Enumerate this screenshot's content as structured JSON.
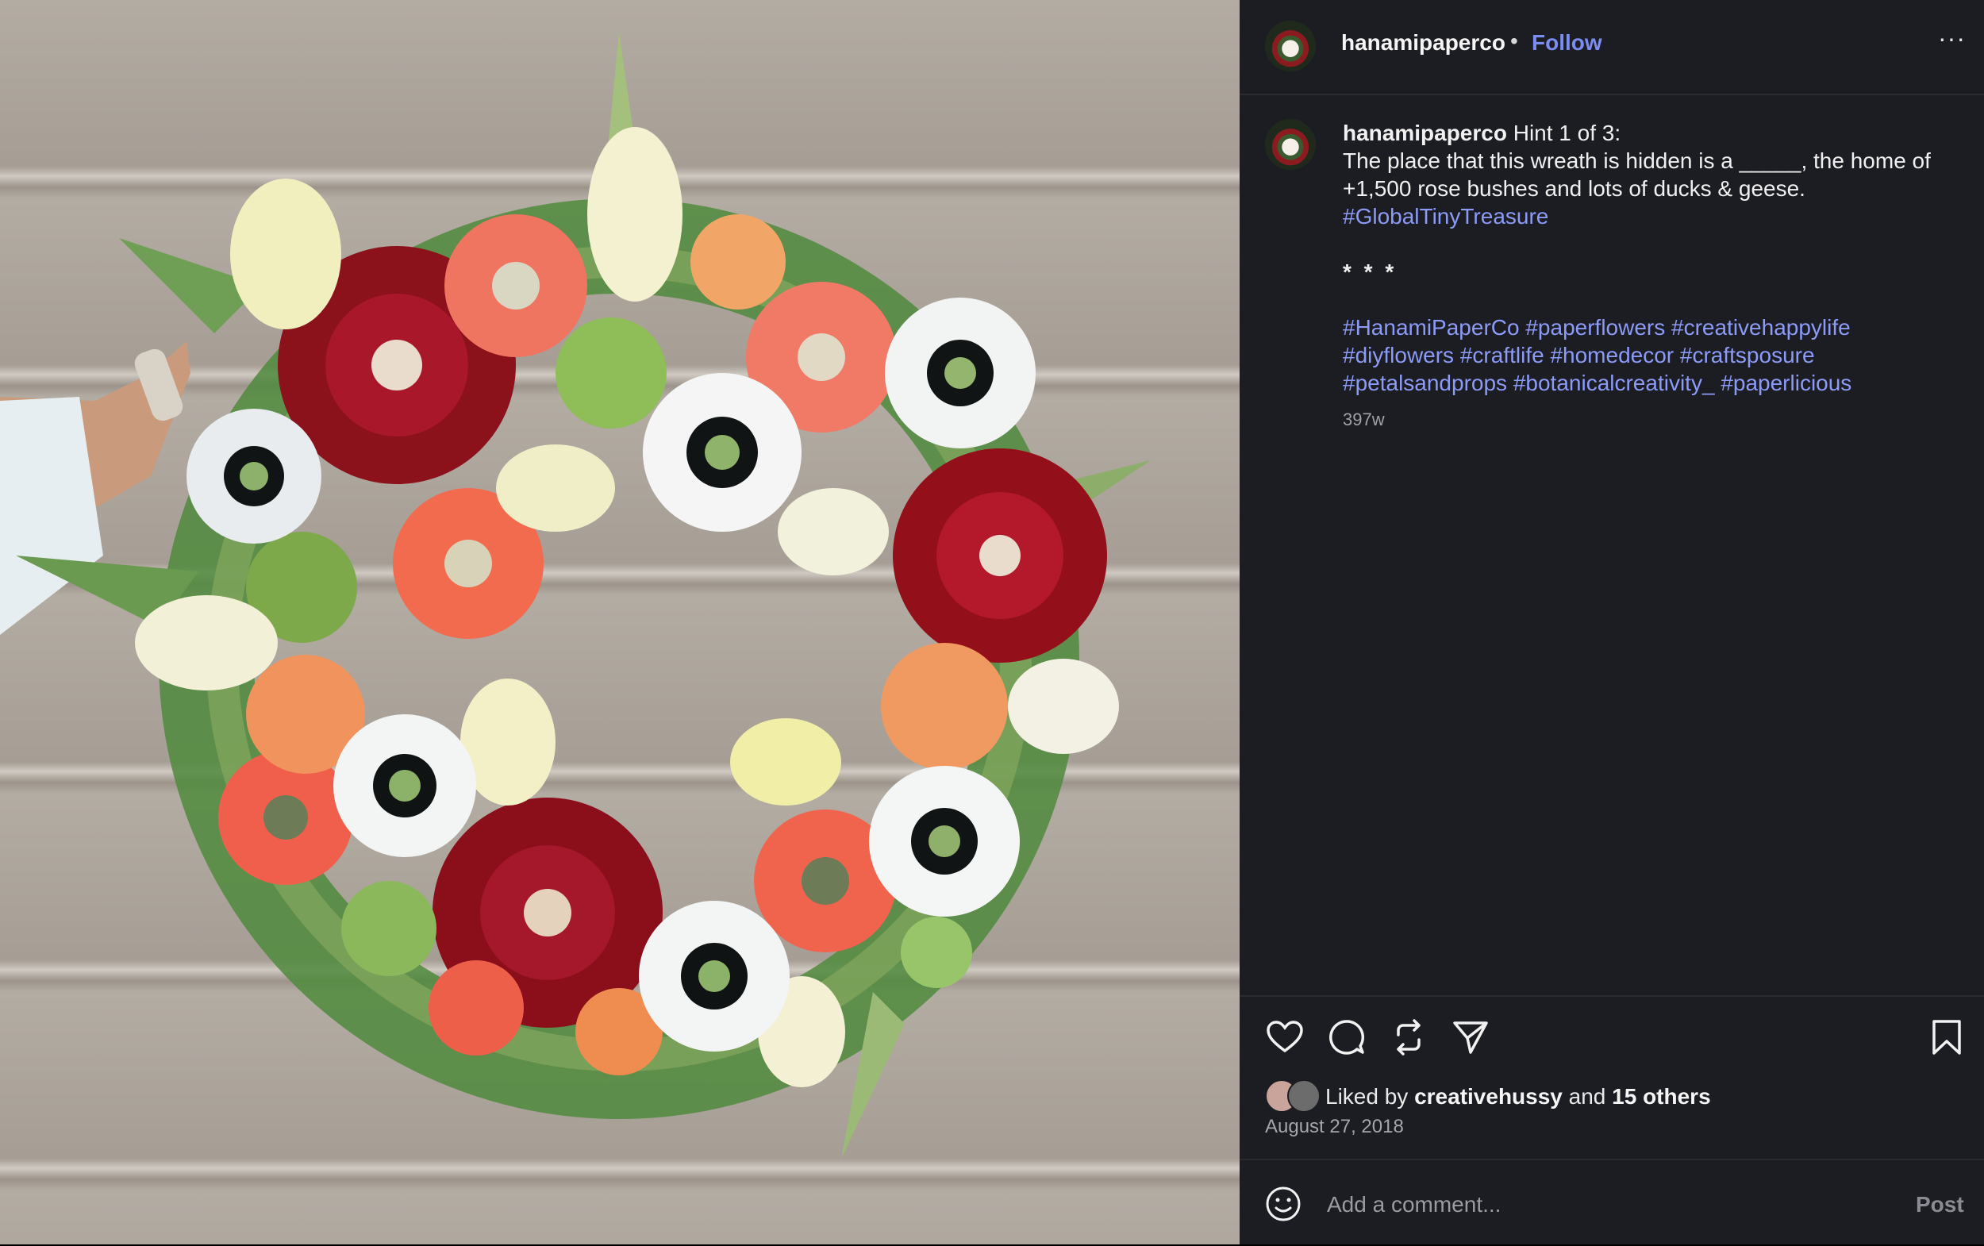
{
  "post": {
    "username": "hanamipaperco",
    "separator": "•",
    "follow_label": "Follow",
    "more_label": "···"
  },
  "caption": {
    "username": "hanamipaperco",
    "line1": "Hint 1 of 3:",
    "line2": "The place that this wreath is hidden is a _____, the home of +1,500 rose bushes and lots of ducks & geese.",
    "hashtag_main": "#GlobalTinyTreasure",
    "stars": "* * *",
    "hashtags": [
      "#HanamiPaperCo",
      "#paperflowers",
      "#creativehappylife",
      "#diyflowers",
      "#craftlife",
      "#homedecor",
      "#craftsposure",
      "#petalsandprops",
      "#botanicalcreativity_",
      "#paperlicious"
    ],
    "age": "397w"
  },
  "actions": {
    "icons": [
      "heart-icon",
      "comment-icon",
      "repost-icon",
      "share-icon",
      "bookmark-icon"
    ]
  },
  "likes": {
    "prefix": "Liked by",
    "user": "creativehussy",
    "conj": "and",
    "others": "15 others"
  },
  "date": "August 27, 2018",
  "comment": {
    "placeholder": "Add a comment...",
    "post_label": "Post"
  },
  "colors": {
    "panel_bg": "#1c1d22",
    "link": "#7b8cf3",
    "hashtag": "#8c9bf8"
  }
}
